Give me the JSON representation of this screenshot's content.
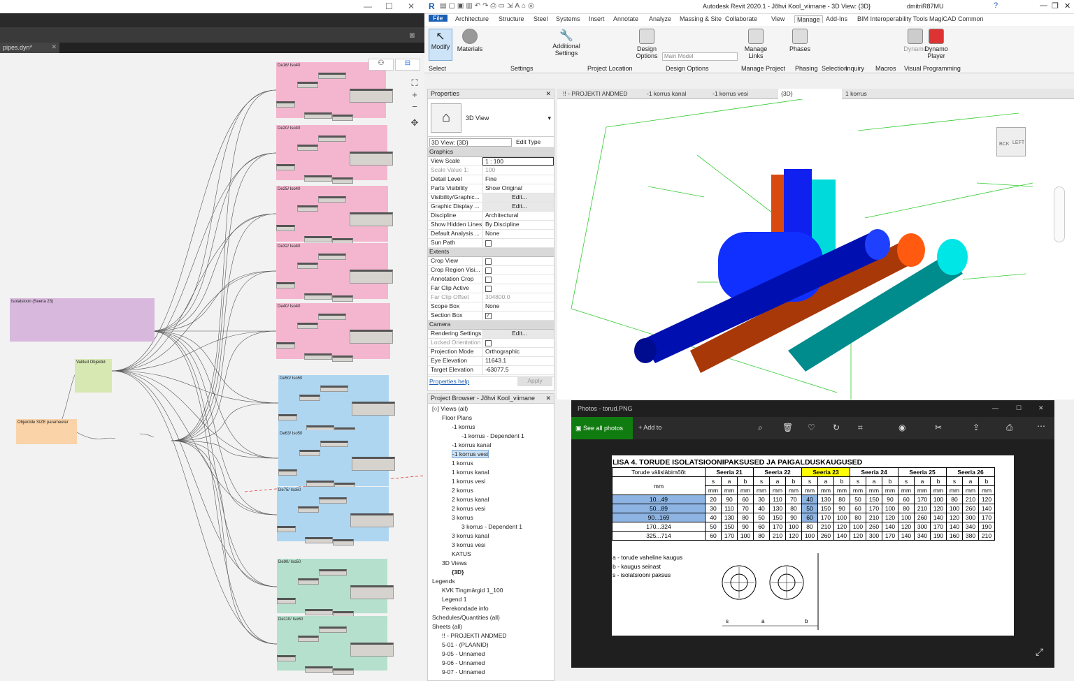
{
  "dynamo": {
    "tab": "pipes.dyn*",
    "groups": [
      {
        "label": "De16/ Iso40",
        "color": "#f4b6cf"
      },
      {
        "label": "De20/ Iso40",
        "color": "#f4b6cf"
      },
      {
        "label": "De25/ Iso40",
        "color": "#f4b6cf"
      },
      {
        "label": "De32/ Iso40",
        "color": "#f4b6cf"
      },
      {
        "label": "De40/ Iso40",
        "color": "#f4b6cf"
      },
      {
        "label": "De50/ Iso50",
        "color": "#aed6f1"
      },
      {
        "label": "De63/ Iso50",
        "color": "#aed6f1"
      },
      {
        "label": "De75/ Iso50",
        "color": "#aed6f1"
      },
      {
        "label": "De90/ Iso50",
        "color": "#b4e0cd"
      },
      {
        "label": "De110/ Iso60",
        "color": "#b4e0cd"
      },
      {
        "label": "Isolatsioon (Seeria 23)",
        "color": "#d8b8dd"
      },
      {
        "label": "Valitud Objektid",
        "color": "#d7e8b2"
      },
      {
        "label": "Objektide SIZE parameeter",
        "color": "#fad3a8"
      }
    ]
  },
  "revit": {
    "title": "Autodesk Revit 2020.1 - Jõhvi Kool_viimane - 3D View: {3D}",
    "user": "dmitriR87MU",
    "ribbon_tabs": [
      "File",
      "Architecture",
      "Structure",
      "Steel",
      "Systems",
      "Insert",
      "Annotate",
      "Analyze",
      "Massing & Site",
      "Collaborate",
      "View",
      "Manage",
      "Add-Ins",
      "BIM Interoperability Tools",
      "MagiCAD Common"
    ],
    "ribbon_buttons": {
      "modify": "Modify",
      "materials": "Materials",
      "additional": "Additional Settings",
      "design_options": "Design Options",
      "main_model": "Main Model",
      "manage_links": "Manage Links",
      "phases": "Phases",
      "dynamo": "Dynamo",
      "dynamo_player": "Dynamo Player"
    },
    "panels": [
      "Select",
      "Settings",
      "Project Location",
      "Design Options",
      "Manage Project",
      "Phasing",
      "Selection",
      "Inquiry",
      "Macros",
      "Visual Programming"
    ],
    "properties": {
      "title": "Properties",
      "type": "3D View",
      "selector": "3D View: {3D}",
      "edit_type": "Edit Type",
      "cat_graphics": "Graphics",
      "graphics": [
        [
          "View Scale",
          "1 : 100"
        ],
        [
          "Scale Value  1:",
          "100"
        ],
        [
          "Detail Level",
          "Fine"
        ],
        [
          "Parts Visibility",
          "Show Original"
        ],
        [
          "Visibility/Graphic...",
          "Edit..."
        ],
        [
          "Graphic Display ...",
          "Edit..."
        ],
        [
          "Discipline",
          "Architectural"
        ],
        [
          "Show Hidden Lines",
          "By Discipline"
        ],
        [
          "Default Analysis ...",
          "None"
        ],
        [
          "Sun Path",
          ""
        ]
      ],
      "cat_extents": "Extents",
      "extents": [
        [
          "Crop View",
          ""
        ],
        [
          "Crop Region Visi...",
          ""
        ],
        [
          "Annotation Crop",
          ""
        ],
        [
          "Far Clip Active",
          ""
        ],
        [
          "Far Clip Offset",
          "304800.0"
        ],
        [
          "Scope Box",
          "None"
        ],
        [
          "Section Box",
          "☑"
        ]
      ],
      "cat_camera": "Camera",
      "camera": [
        [
          "Rendering Settings",
          "Edit..."
        ],
        [
          "Locked Orientation",
          ""
        ],
        [
          "Projection Mode",
          "Orthographic"
        ],
        [
          "Eye Elevation",
          "11643.1"
        ],
        [
          "Target Elevation",
          "-63077.5"
        ]
      ],
      "help": "Properties help",
      "apply": "Apply"
    },
    "browser": {
      "title": "Project Browser - Jõhvi Kool_viimane",
      "items": [
        {
          "t": "[○] Views (all)",
          "l": 0
        },
        {
          "t": "Floor Plans",
          "l": 1
        },
        {
          "t": "-1 korrus",
          "l": 2
        },
        {
          "t": "-1 korrus - Dependent 1",
          "l": 3
        },
        {
          "t": "-1 korrus kanal",
          "l": 2
        },
        {
          "t": "-1 korrus vesi",
          "l": 2
        },
        {
          "t": "1 korrus",
          "l": 2
        },
        {
          "t": "1 korrus kanal",
          "l": 2
        },
        {
          "t": "1 korrus vesi",
          "l": 2
        },
        {
          "t": "2 korrus",
          "l": 2
        },
        {
          "t": "2 korrus kanal",
          "l": 2
        },
        {
          "t": "2 korrus vesi",
          "l": 2
        },
        {
          "t": "3 korrus",
          "l": 2
        },
        {
          "t": "3 korrus - Dependent 1",
          "l": 3
        },
        {
          "t": "3 korrus kanal",
          "l": 2
        },
        {
          "t": "3 korrus vesi",
          "l": 2
        },
        {
          "t": "KATUS",
          "l": 2
        },
        {
          "t": "3D Views",
          "l": 1
        },
        {
          "t": "{3D}",
          "l": 2
        },
        {
          "t": "Legends",
          "l": 0
        },
        {
          "t": "KVK Tingmärgid 1_100",
          "l": 1
        },
        {
          "t": "Legend 1",
          "l": 1
        },
        {
          "t": "Perekondade info",
          "l": 1
        },
        {
          "t": "Schedules/Quantities (all)",
          "l": 0
        },
        {
          "t": "Sheets (all)",
          "l": 0
        },
        {
          "t": "!! - PROJEKTI ANDMED",
          "l": 1
        },
        {
          "t": "5-01 - (PLAANID)",
          "l": 1
        },
        {
          "t": "9-05 - Unnamed",
          "l": 1
        },
        {
          "t": "9-06 - Unnamed",
          "l": 1
        },
        {
          "t": "9-07 - Unnamed",
          "l": 1
        }
      ]
    },
    "view_tabs": [
      "!! - PROJEKTI ANDMED",
      "-1 korrus kanal",
      "-1 korrus vesi",
      "{3D}",
      "1 korrus"
    ],
    "viewcube": {
      "top": "BCK",
      "left": "LEFT"
    }
  },
  "photos": {
    "title": "Photos - torud.PNG",
    "see_all": "See all photos",
    "add_to": "Add to",
    "table_title": "LISA 4. TORUDE ISOLATSIOONIPAKSUSED JA PAIGALDUSKAUGUSED",
    "col_head": "Torude välisläbimõõt",
    "unit": "mm",
    "series": [
      "Seeria 21",
      "Seeria 22",
      "Seeria 23",
      "Seeria 24",
      "Seeria 25",
      "Seeria 26"
    ],
    "subcols": [
      "s",
      "a",
      "b"
    ],
    "rows": [
      {
        "range": "10...49",
        "v": [
          20,
          90,
          60,
          30,
          110,
          70,
          40,
          130,
          80,
          50,
          150,
          90,
          60,
          170,
          100,
          80,
          210,
          120
        ]
      },
      {
        "range": "50...89",
        "v": [
          30,
          110,
          70,
          40,
          130,
          80,
          50,
          150,
          90,
          60,
          170,
          100,
          80,
          210,
          120,
          100,
          260,
          140
        ]
      },
      {
        "range": "90...169",
        "v": [
          40,
          130,
          80,
          50,
          150,
          90,
          60,
          170,
          100,
          80,
          210,
          120,
          100,
          260,
          140,
          120,
          300,
          170
        ]
      },
      {
        "range": "170...324",
        "v": [
          50,
          150,
          90,
          60,
          170,
          100,
          80,
          210,
          120,
          100,
          260,
          140,
          120,
          300,
          170,
          140,
          340,
          190
        ]
      },
      {
        "range": "325...714",
        "v": [
          60,
          170,
          100,
          80,
          210,
          120,
          100,
          260,
          140,
          120,
          300,
          170,
          140,
          340,
          190,
          160,
          380,
          210
        ]
      }
    ],
    "legend": [
      "a - torude vaheline kaugus",
      "b - kaugus seinast",
      "s - isolatsiooni paksus"
    ],
    "dim_labels": [
      "s",
      "a",
      "b"
    ]
  }
}
